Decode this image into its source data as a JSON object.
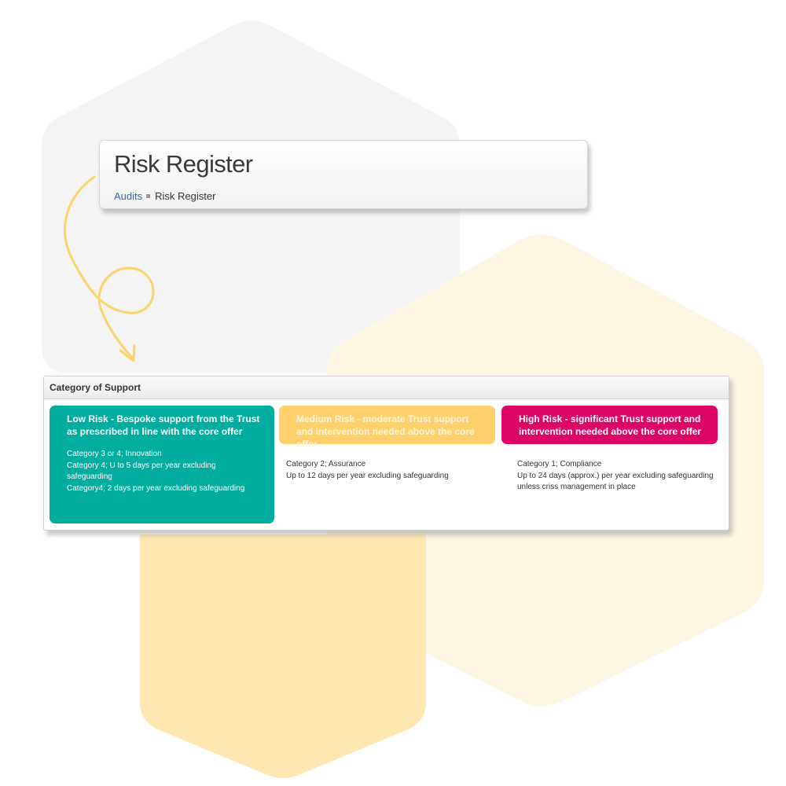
{
  "header": {
    "title": "Risk Register",
    "breadcrumb": {
      "parent": "Audits",
      "current": "Risk Register"
    }
  },
  "support_panel": {
    "heading": "Category of Support",
    "columns": [
      {
        "risk_level": "low",
        "color": "#00ad9f",
        "title": "Low Risk - Bespoke support from the Trust as prescribed in line with the core offer",
        "details": [
          "Category 3 or 4; Innovation",
          "Category 4; U to 5 days per year excluding safeguarding",
          "Category4; 2 days per year excluding safeguarding"
        ]
      },
      {
        "risk_level": "medium",
        "color": "#ffd06b",
        "title": "Medium Risk - moderate Trust support and intervention needed above the core offer",
        "details": [
          "Category 2; Assurance",
          "Up to 12 days per year excluding safeguarding"
        ]
      },
      {
        "risk_level": "high",
        "color": "#dd0566",
        "title": "High Risk - significant Trust support and intervention needed above the core offer",
        "details": [
          "Category 1; Compliance",
          "Up to 24 days (approx.) per year excluding safeguarding unless criss management in place"
        ]
      }
    ]
  },
  "decoration": {
    "hexagon_grey": "#f4f4f4",
    "hexagon_yellow_light": "#fdf6e3",
    "hexagon_yellow": "#ffe7b1",
    "arrow_color": "#f9d56c"
  }
}
